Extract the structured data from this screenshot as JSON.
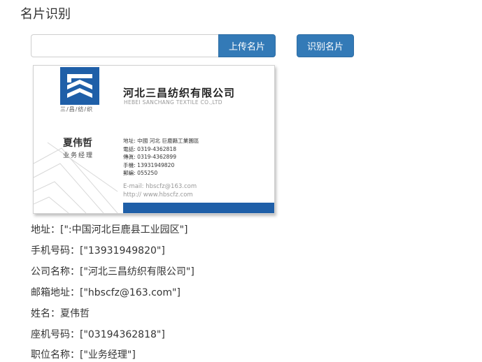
{
  "page": {
    "title": "名片识别"
  },
  "upload": {
    "input_value": "",
    "upload_button": "上传名片",
    "recognize_button": "识别名片"
  },
  "card": {
    "logo_text": "三/昌/纺/织",
    "company_cn": "河北三昌纺织有限公司",
    "company_en": "HEBEI SANCHANG TEXTILE CO.,LTD",
    "name": "夏伟哲",
    "title": "业务经理",
    "contact_lines": [
      "地址: 中國 河北 巨鹿縣工業園區",
      "電話: 0319-4362818",
      "傳眞: 0319-4362899",
      "手機: 13931949820",
      "郵編: 055250"
    ],
    "email": "E-mail: hbscfz@163.com",
    "website": "http:// www.hbscfz.com",
    "brand_color": "#1f5fa8"
  },
  "results": [
    {
      "label": "地址：",
      "value": "[\":中国河北巨鹿县工业园区\"]"
    },
    {
      "label": "手机号码：",
      "value": "[\"13931949820\"]"
    },
    {
      "label": "公司名称：",
      "value": "[\"河北三昌纺织有限公司\"]"
    },
    {
      "label": "邮箱地址：",
      "value": "[\"hbscfz@163.com\"]"
    },
    {
      "label": "姓名：",
      "value": "夏伟哲"
    },
    {
      "label": "座机号码：",
      "value": "[\"03194362818\"]"
    },
    {
      "label": "职位名称：",
      "value": "[\"业务经理\"]"
    }
  ],
  "colors": {
    "primary_button": "#337ab7",
    "text": "#333333"
  }
}
